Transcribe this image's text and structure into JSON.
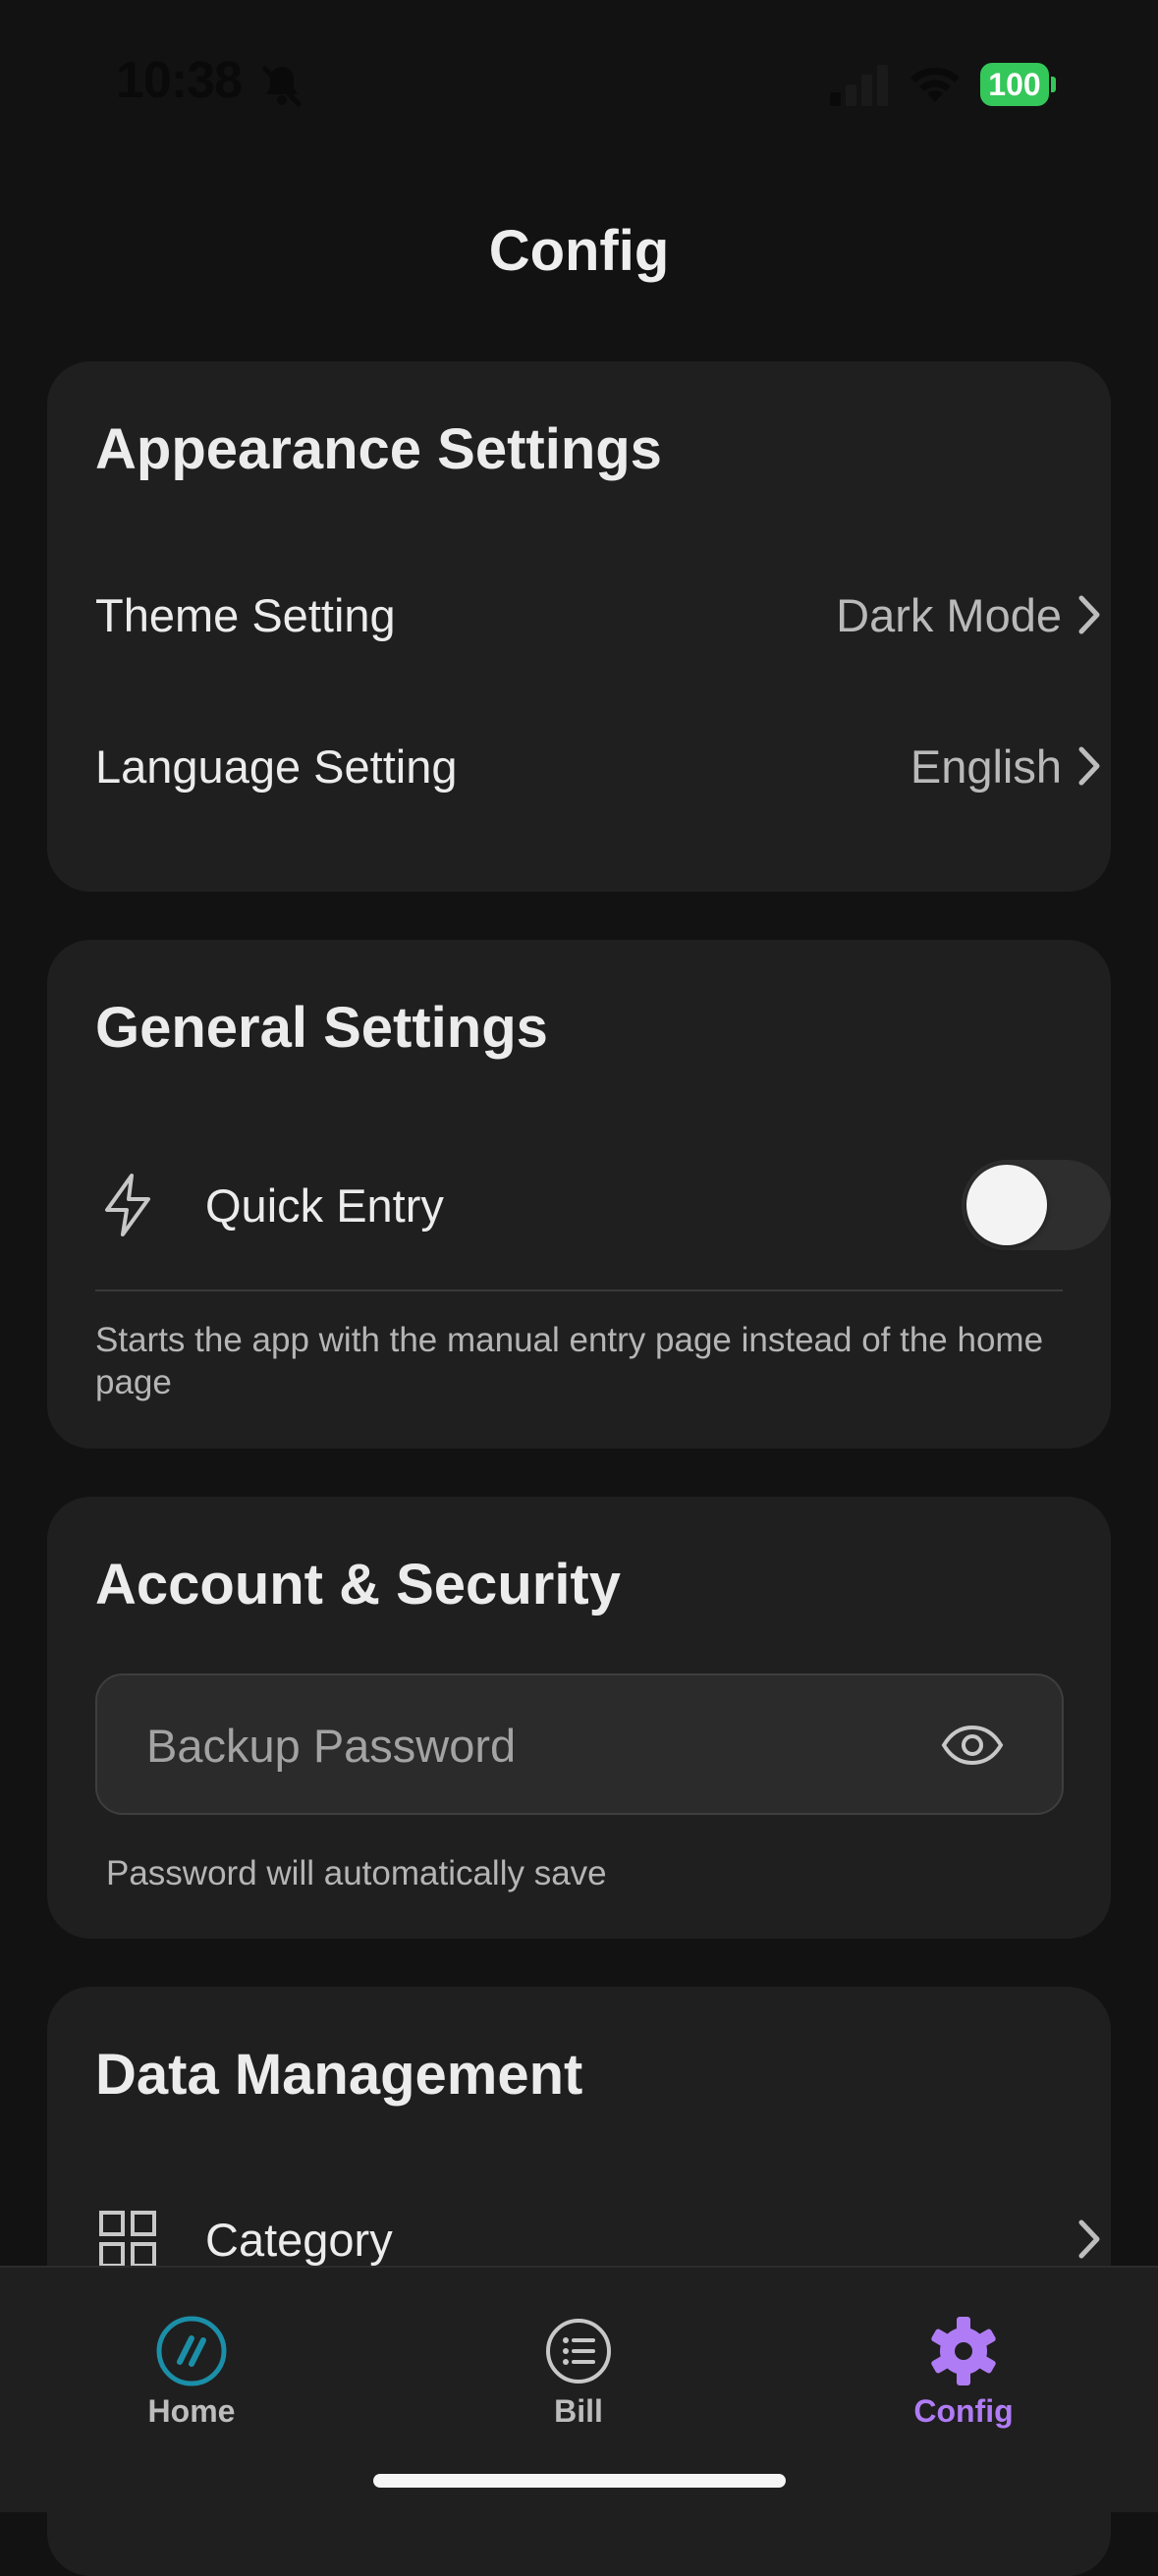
{
  "status_bar": {
    "time": "10:38",
    "battery": "100"
  },
  "header": {
    "title": "Config"
  },
  "appearance": {
    "title": "Appearance Settings",
    "theme_label": "Theme Setting",
    "theme_value": "Dark Mode",
    "language_label": "Language Setting",
    "language_value": "English"
  },
  "general": {
    "title": "General Settings",
    "quick_entry_label": "Quick Entry",
    "quick_entry_enabled": false,
    "quick_entry_help": "Starts the app with the manual entry page instead of the home page"
  },
  "account": {
    "title": "Account & Security",
    "password_placeholder": "Backup Password",
    "password_help": "Password will automatically save"
  },
  "data_management": {
    "title": "Data Management",
    "category_label": "Category"
  },
  "tabs": [
    {
      "label": "Home",
      "icon": "home-logo-icon",
      "active": false
    },
    {
      "label": "Bill",
      "icon": "list-icon",
      "active": false
    },
    {
      "label": "Config",
      "icon": "gear-icon",
      "active": true
    }
  ],
  "colors": {
    "background": "#121212",
    "card": "#1f1f1f",
    "accent": "#b07cf5",
    "battery": "#34c759"
  }
}
